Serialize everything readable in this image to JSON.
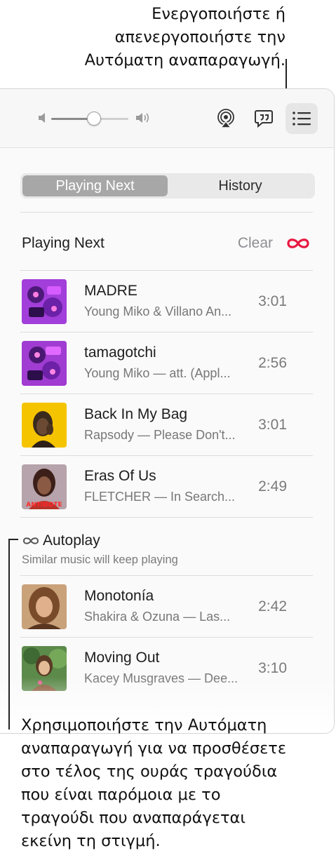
{
  "callouts": {
    "top_line1": "Ενεργοποιήστε ή",
    "top_line2": "απενεργοποιήστε την",
    "top_line3": "Αυτόματη αναπαραγωγή.",
    "bottom_line1": "Χρησιμοποιήστε την Αυτόματη",
    "bottom_line2": "αναπαραγωγή για να προσθέσετε",
    "bottom_line3": "στο τέλος της ουράς τραγούδια",
    "bottom_line4": "που είναι παρόμοια με το",
    "bottom_line5": "τραγούδι που αναπαράγεται",
    "bottom_line6": "εκείνη τη στιγμή."
  },
  "toolbar": {
    "volume_level": 0.55,
    "icons": [
      "volume-low-icon",
      "volume-high-icon",
      "airplay-icon",
      "lyrics-icon",
      "queue-list-icon"
    ]
  },
  "segmented": {
    "playing_next": "Playing Next",
    "history": "History",
    "selected": "Playing Next"
  },
  "queue_header": {
    "title": "Playing Next",
    "clear": "Clear",
    "autoplay_color": "#e8183f"
  },
  "up_next": [
    {
      "title": "MADRE",
      "subtitle": "Young Miko & Villano An...",
      "duration": "3:01"
    },
    {
      "title": "tamagotchi",
      "subtitle": "Young Miko — att. (Appl...",
      "duration": "2:56"
    },
    {
      "title": "Back In My Bag",
      "subtitle": "Rapsody — Please Don't...",
      "duration": "3:01"
    },
    {
      "title": "Eras Of Us",
      "subtitle": "FLETCHER — In Search...",
      "duration": "2:49"
    }
  ],
  "autoplay": {
    "title": "Autoplay",
    "subtitle": "Similar music will keep playing",
    "tracks": [
      {
        "title": "Monotonía",
        "subtitle": "Shakira & Ozuna — Las...",
        "duration": "2:42"
      },
      {
        "title": "Moving Out",
        "subtitle": "Kacey Musgraves — Dee...",
        "duration": "3:10"
      }
    ]
  },
  "art": {
    "madre": "ANTIDOTE-free purple artwork",
    "eras_of_us_art_text": "ANTIDOTE"
  }
}
